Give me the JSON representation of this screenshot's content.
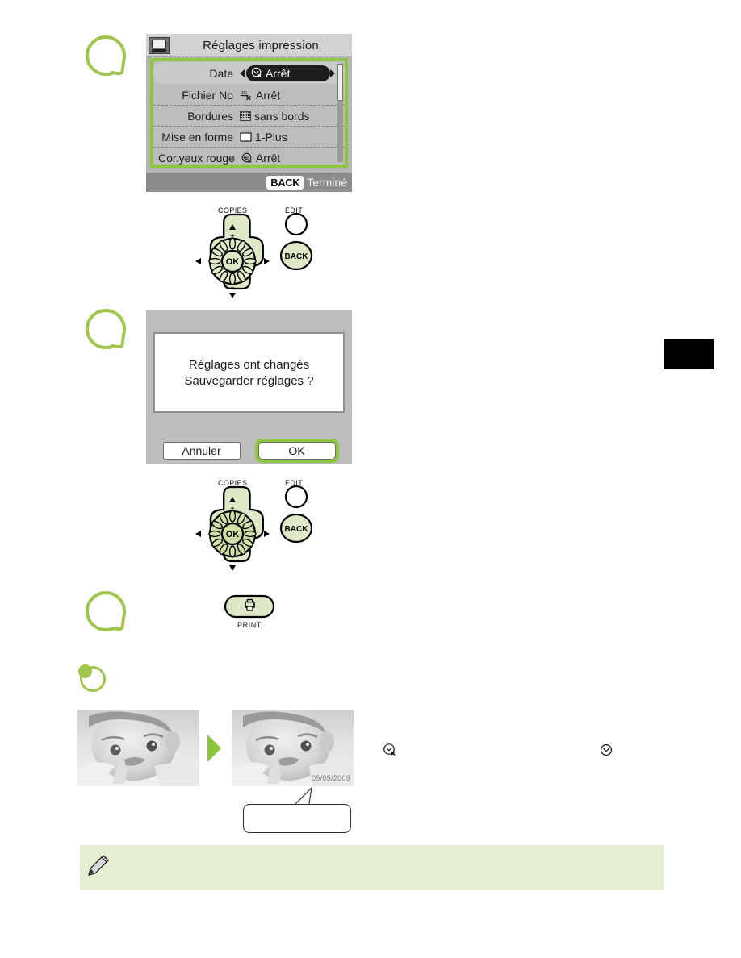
{
  "page": {
    "language": "fr",
    "accent_green": "#8ec63f",
    "marker_green": "#9fc54d",
    "note_bg": "#e5eed0"
  },
  "steps": [
    {
      "id": "step-1",
      "marker": "speech-bubble",
      "label": ""
    },
    {
      "id": "step-2",
      "marker": "speech-bubble",
      "label": ""
    },
    {
      "id": "step-3",
      "marker": "speech-bubble",
      "label": ""
    },
    {
      "id": "result",
      "marker": "result-circle",
      "label": ""
    }
  ],
  "print_settings_screen": {
    "header": {
      "icon": "print-settings-icon",
      "title": "Réglages impression"
    },
    "rows": [
      {
        "label": "Date",
        "value": "Arrêt",
        "icon": "clock-off-icon",
        "selected": true
      },
      {
        "label": "Fichier No",
        "value": "Arrêt",
        "icon": "file-number-off-icon",
        "selected": false
      },
      {
        "label": "Bordures",
        "value": "sans bords",
        "icon": "border-pattern-icon",
        "selected": false
      },
      {
        "label": "Mise en forme",
        "value": "1-Plus",
        "icon": "layout-square-icon",
        "selected": false
      },
      {
        "label": "Cor.yeux rouge",
        "value": "Arrêt",
        "icon": "red-eye-off-icon",
        "selected": false
      }
    ],
    "footer": {
      "button_chip": "BACK",
      "text": "Terminé"
    }
  },
  "confirm_screen": {
    "message_line1": "Réglages ont changés",
    "message_line2": "Sauvegarder réglages ?",
    "cancel_label": "Annuler",
    "ok_label": "OK",
    "highlighted_button": "OK"
  },
  "control_pad": {
    "copies_label": "COPIES",
    "edit_label": "EDIT",
    "back_label": "BACK",
    "ok_label": "OK",
    "up_label": "+",
    "down_label": "−"
  },
  "print_button": {
    "label": "PRINT",
    "icon": "printer-icon"
  },
  "result_photos": {
    "before": {
      "alt": "baby-photo-before",
      "stamp": ""
    },
    "after": {
      "alt": "baby-photo-after",
      "stamp": "05/05/2009"
    },
    "callout_text": ""
  },
  "legend_icons": [
    {
      "name": "clock-off-icon",
      "meaning": "Date Arrêt"
    },
    {
      "name": "clock-on-icon",
      "meaning": "Date Marche"
    }
  ],
  "note": {
    "icon": "pencil-icon",
    "text": ""
  }
}
